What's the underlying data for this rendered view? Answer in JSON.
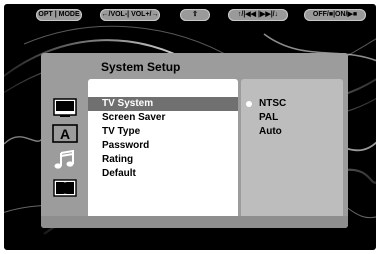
{
  "remote_buttons": [
    {
      "label": "OPT | MODE"
    },
    {
      "label": "←/VOL-| VOL+/→"
    },
    {
      "label": "⇧"
    },
    {
      "label": "↑/|◀◀ |▶▶|/↓"
    },
    {
      "label": "OFF/■|ON/▶■"
    }
  ],
  "panel": {
    "title": "System  Setup",
    "icons": [
      "monitor-icon",
      "subtitle-a-icon",
      "music-note-icon",
      "dolby-icon"
    ],
    "icon_letter": "A",
    "menu": [
      {
        "label": "TV  System",
        "selected": true
      },
      {
        "label": "Screen  Saver",
        "selected": false
      },
      {
        "label": "TV Type",
        "selected": false
      },
      {
        "label": "Password",
        "selected": false
      },
      {
        "label": "Rating",
        "selected": false
      },
      {
        "label": "Default",
        "selected": false
      }
    ],
    "options": [
      {
        "label": "NTSC",
        "active": true
      },
      {
        "label": "PAL",
        "active": false
      },
      {
        "label": "Auto",
        "active": false
      }
    ]
  },
  "colors": {
    "screen_bg": "#000000",
    "panel_bg": "#9c9c9c",
    "menu_bg": "#ffffff",
    "selected_bg": "#707070",
    "options_bg": "#bdbdbd"
  }
}
